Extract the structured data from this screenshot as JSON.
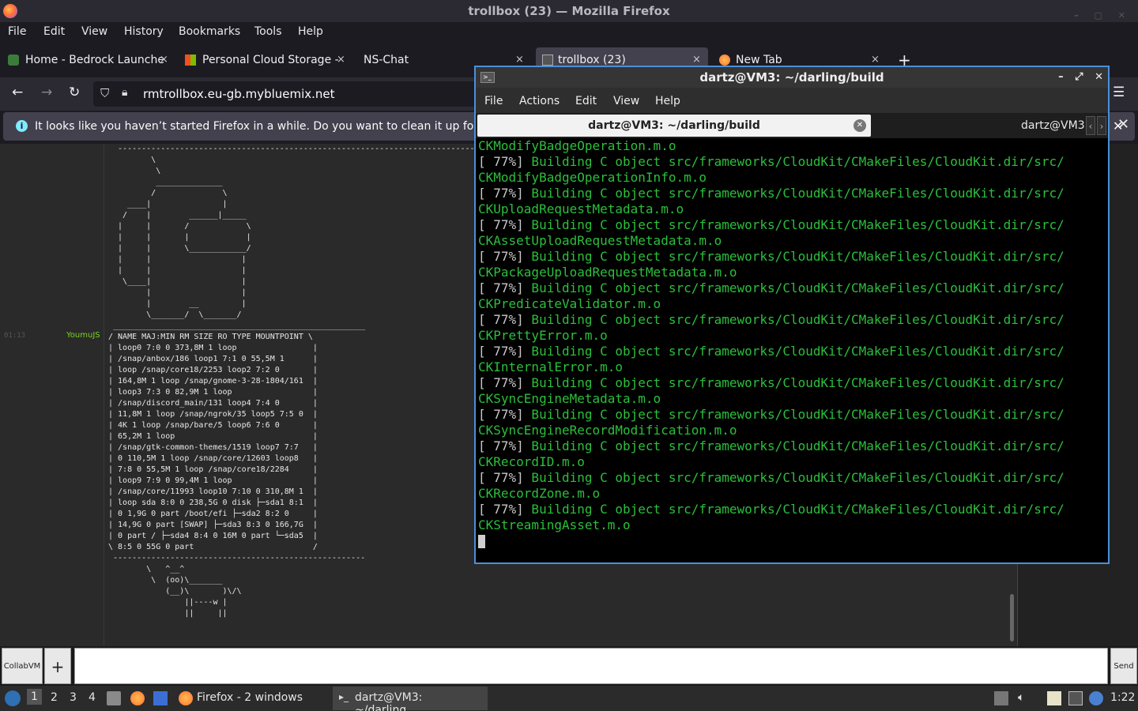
{
  "firefox": {
    "window_title": "trollbox (23) — Mozilla Firefox",
    "menu": [
      "File",
      "Edit",
      "View",
      "History",
      "Bookmarks",
      "Tools",
      "Help"
    ],
    "tabs": [
      {
        "label": "Home - Bedrock Launche",
        "close": "×"
      },
      {
        "label": "Personal Cloud Storage -",
        "close": "×"
      },
      {
        "label": "NS-Chat",
        "close": "×"
      },
      {
        "label": "trollbox (23)",
        "close": "×"
      },
      {
        "label": "New Tab",
        "close": "×"
      }
    ],
    "new_tab": "+",
    "url": "rmtrollbox.eu-gb.mybluemix.net",
    "notification": "It looks like you haven’t started Firefox in a while. Do you want to clean it up for a f",
    "notification_close": "✕"
  },
  "chat": {
    "time": "01:13",
    "user": "YoumuJS",
    "ascii_art": "  ------------------------------------------------------------------------------------\n         \\\n          \\\n          ______________\n         /              \\\n    ____|               |\n   /    |        ______|_____\n  |     |       /            \\\n  |     |       |            |\n  |     |       \\____________/\n  |     |                   |\n  |     |                   |\n   \\____|                   |\n        |                   |\n        |        __         |\n        \\_______/  \\_______/\n _____________________________________________________\n/ NAME MAJ:MIN RM SIZE RO TYPE MOUNTPOINT \\\n| loop0 7:0 0 373,8M 1 loop                |\n| /snap/anbox/186 loop1 7:1 0 55,5M 1      |\n| loop /snap/core18/2253 loop2 7:2 0       |\n| 164,8M 1 loop /snap/gnome-3-28-1804/161  |\n| loop3 7:3 0 82,9M 1 loop                 |\n| /snap/discord_main/131 loop4 7:4 0       |\n| 11,8M 1 loop /snap/ngrok/35 loop5 7:5 0  |\n| 4K 1 loop /snap/bare/5 loop6 7:6 0       |\n| 65,2M 1 loop                             |\n| /snap/gtk-common-themes/1519 loop7 7:7   |\n| 0 110,5M 1 loop /snap/core/12603 loop8   |\n| 7:8 0 55,5M 1 loop /snap/core18/2284     |\n| loop9 7:9 0 99,4M 1 loop                 |\n| /snap/core/11993 loop10 7:10 0 310,8M 1  |\n| loop sda 8:0 0 238,5G 0 disk ├─sda1 8:1  |\n| 0 1,9G 0 part /boot/efi ├─sda2 8:2 0     |\n| 14,9G 0 part [SWAP] ├─sda3 8:3 0 166,7G  |\n| 0 part / ├─sda4 8:4 0 16M 0 part └─sda5  |\n\\ 8:5 0 55G 0 part                         /\n -----------------------------------------------------\n        \\   ^__^\n         \\  (oo)\\_______\n            (__)\\       )\\/\\\n                ||----w |\n                ||     ||",
    "collab_btn": "CollabVM",
    "plus_btn": "+",
    "send_btn": "Send"
  },
  "terminal": {
    "title": "dartz@VM3: ~/darling/build",
    "menu": [
      "File",
      "Actions",
      "Edit",
      "View",
      "Help"
    ],
    "tab_active": "dartz@VM3: ~/darling/build",
    "tab_inactive": "dartz@VM3",
    "lines": [
      {
        "pct": "",
        "text": "CKModifyBadgeOperation.m.o"
      },
      {
        "pct": "[ 77%]",
        "text": " Building C object src/frameworks/CloudKit/CMakeFiles/CloudKit.dir/src/"
      },
      {
        "pct": "",
        "text": "CKModifyBadgeOperationInfo.m.o"
      },
      {
        "pct": "[ 77%]",
        "text": " Building C object src/frameworks/CloudKit/CMakeFiles/CloudKit.dir/src/"
      },
      {
        "pct": "",
        "text": "CKUploadRequestMetadata.m.o"
      },
      {
        "pct": "[ 77%]",
        "text": " Building C object src/frameworks/CloudKit/CMakeFiles/CloudKit.dir/src/"
      },
      {
        "pct": "",
        "text": "CKAssetUploadRequestMetadata.m.o"
      },
      {
        "pct": "[ 77%]",
        "text": " Building C object src/frameworks/CloudKit/CMakeFiles/CloudKit.dir/src/"
      },
      {
        "pct": "",
        "text": "CKPackageUploadRequestMetadata.m.o"
      },
      {
        "pct": "[ 77%]",
        "text": " Building C object src/frameworks/CloudKit/CMakeFiles/CloudKit.dir/src/"
      },
      {
        "pct": "",
        "text": "CKPredicateValidator.m.o"
      },
      {
        "pct": "[ 77%]",
        "text": " Building C object src/frameworks/CloudKit/CMakeFiles/CloudKit.dir/src/"
      },
      {
        "pct": "",
        "text": "CKPrettyError.m.o"
      },
      {
        "pct": "[ 77%]",
        "text": " Building C object src/frameworks/CloudKit/CMakeFiles/CloudKit.dir/src/"
      },
      {
        "pct": "",
        "text": "CKInternalError.m.o"
      },
      {
        "pct": "[ 77%]",
        "text": " Building C object src/frameworks/CloudKit/CMakeFiles/CloudKit.dir/src/"
      },
      {
        "pct": "",
        "text": "CKSyncEngineMetadata.m.o"
      },
      {
        "pct": "[ 77%]",
        "text": " Building C object src/frameworks/CloudKit/CMakeFiles/CloudKit.dir/src/"
      },
      {
        "pct": "",
        "text": "CKSyncEngineRecordModification.m.o"
      },
      {
        "pct": "[ 77%]",
        "text": " Building C object src/frameworks/CloudKit/CMakeFiles/CloudKit.dir/src/"
      },
      {
        "pct": "",
        "text": "CKRecordID.m.o"
      },
      {
        "pct": "[ 77%]",
        "text": " Building C object src/frameworks/CloudKit/CMakeFiles/CloudKit.dir/src/"
      },
      {
        "pct": "",
        "text": "CKRecordZone.m.o"
      },
      {
        "pct": "[ 77%]",
        "text": " Building C object src/frameworks/CloudKit/CMakeFiles/CloudKit.dir/src/"
      },
      {
        "pct": "",
        "text": "CKStreamingAsset.m.o"
      }
    ]
  },
  "taskbar": {
    "workspaces": [
      "1",
      "2",
      "3",
      "4"
    ],
    "firefox_task": "Firefox - 2 windows",
    "terminal_task": "dartz@VM3: ~/darling...",
    "clock": "1:22"
  }
}
